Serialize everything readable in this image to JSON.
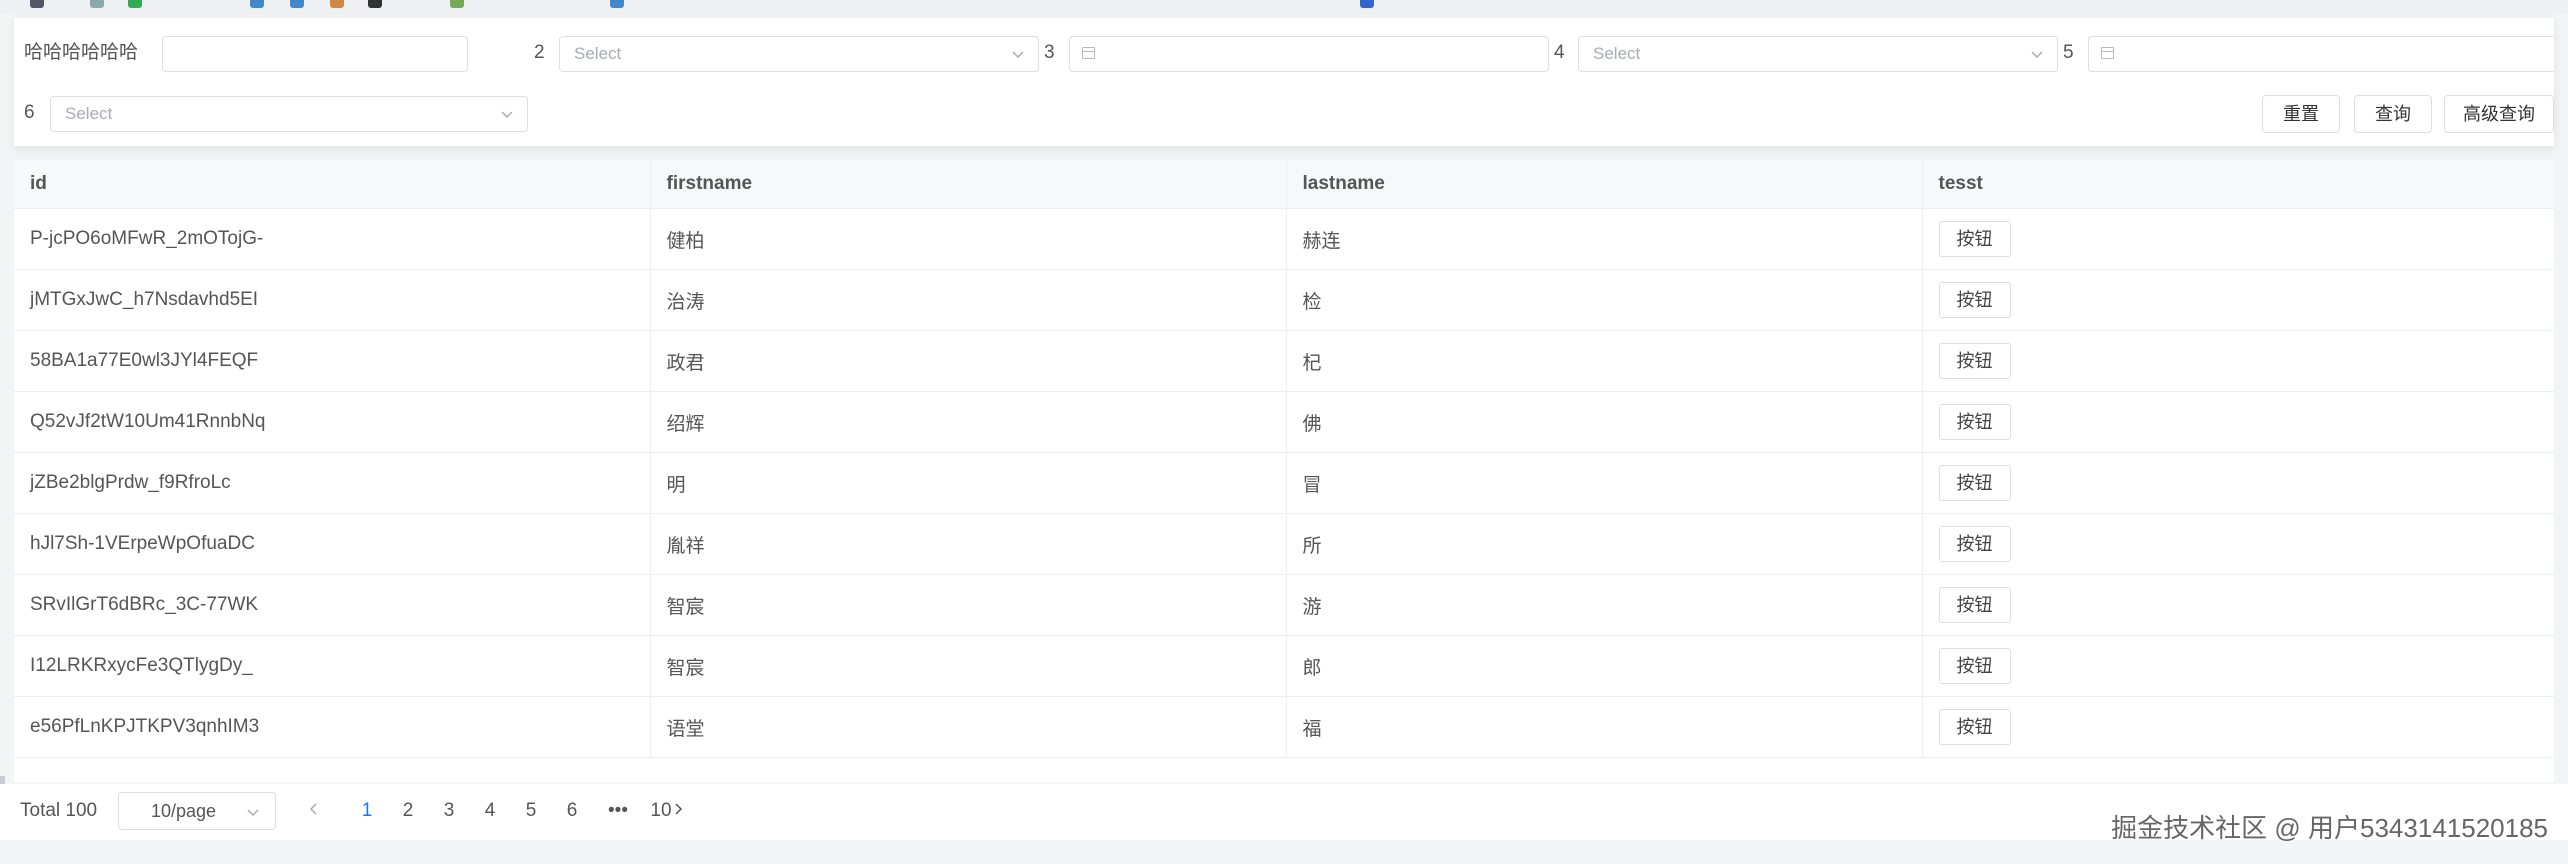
{
  "filters": {
    "row1": [
      {
        "label": "哈哈哈哈哈哈",
        "type": "text",
        "placeholder": ""
      },
      {
        "label": "2",
        "type": "select",
        "placeholder": "Select"
      },
      {
        "label": "3",
        "type": "date",
        "placeholder": ""
      },
      {
        "label": "4",
        "type": "select",
        "placeholder": "Select"
      },
      {
        "label": "5",
        "type": "date",
        "placeholder": ""
      }
    ],
    "row2": [
      {
        "label": "6",
        "type": "select",
        "placeholder": "Select"
      }
    ],
    "buttons": {
      "reset": "重置",
      "query": "查询",
      "advanced": "高级查询"
    }
  },
  "table": {
    "columns": [
      "id",
      "firstname",
      "lastname",
      "tesst"
    ],
    "rows": [
      {
        "id": "P-jcPO6oMFwR_2mOTojG-",
        "firstname": "健柏",
        "lastname": "赫连",
        "action": "按钮"
      },
      {
        "id": "jMTGxJwC_h7Nsdavhd5EI",
        "firstname": "治涛",
        "lastname": "检",
        "action": "按钮"
      },
      {
        "id": "58BA1a77E0wl3JYl4FEQF",
        "firstname": "政君",
        "lastname": "杞",
        "action": "按钮"
      },
      {
        "id": "Q52vJf2tW10Um41RnnbNq",
        "firstname": "绍辉",
        "lastname": "佛",
        "action": "按钮"
      },
      {
        "id": "jZBe2blgPrdw_f9RfroLc",
        "firstname": "明",
        "lastname": "冒",
        "action": "按钮"
      },
      {
        "id": "hJl7Sh-1VErpeWpOfuaDC",
        "firstname": "胤祥",
        "lastname": "所",
        "action": "按钮"
      },
      {
        "id": "SRvIlGrT6dBRc_3C-77WK",
        "firstname": "智宸",
        "lastname": "游",
        "action": "按钮"
      },
      {
        "id": "I12LRKRxycFe3QTlygDy_",
        "firstname": "智宸",
        "lastname": "郎",
        "action": "按钮"
      },
      {
        "id": "e56PfLnKPJTKPV3qnhIM3",
        "firstname": "语堂",
        "lastname": "福",
        "action": "按钮"
      }
    ]
  },
  "pagination": {
    "total_label": "Total 100",
    "page_size": "10/page",
    "pages": [
      "1",
      "2",
      "3",
      "4",
      "5",
      "6",
      "•••",
      "10"
    ],
    "active_page": "1",
    "prev_icon": "chevron-left-icon",
    "next_icon": "chevron-right-icon"
  },
  "watermark": "掘金技术社区 @ 用户5343141520185",
  "colors": {
    "accent": "#1677ff",
    "border": "#dcdfe6",
    "header_bg": "#f7f8fa"
  }
}
